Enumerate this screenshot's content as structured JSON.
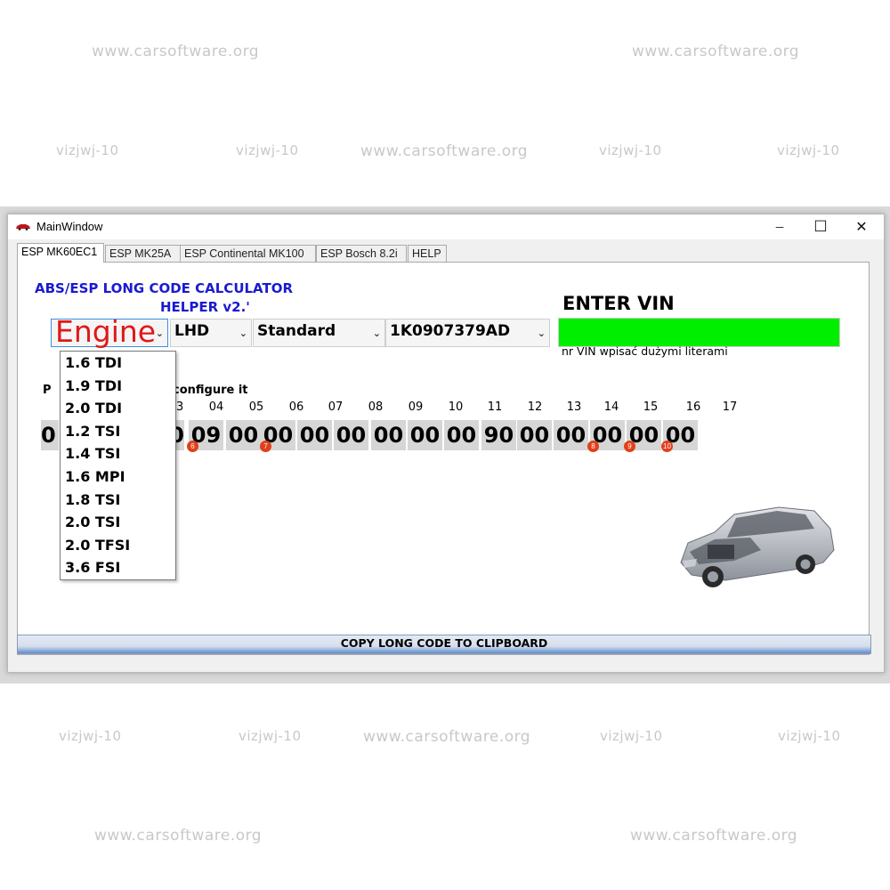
{
  "watermarks": {
    "site": "www.carsoftware.org",
    "code": "vizjwj-10"
  },
  "window": {
    "title": "MainWindow",
    "controls": {
      "minimize": "─",
      "maximize": "☐",
      "close": "✕"
    }
  },
  "tabs": [
    {
      "label": "ESP MK60EC1",
      "active": true
    },
    {
      "label": "ESP MK25A",
      "active": false
    },
    {
      "label": "ESP Continental MK100",
      "active": false
    },
    {
      "label": "ESP Bosch 8.2i",
      "active": false
    },
    {
      "label": "HELP",
      "active": false
    }
  ],
  "panel": {
    "heading_line1": "ABS/ESP LONG CODE CALCULATOR",
    "heading_line2": "HELPER v2.'",
    "heading_color": "#1a1ad0",
    "combos": {
      "engine": {
        "value": "Engine"
      },
      "drive": {
        "value": "LHD"
      },
      "variant": {
        "value": "Standard"
      },
      "part_number": {
        "value": "1K0907379AD"
      }
    },
    "engine_options": [
      "1.6 TDI",
      "1.9 TDI",
      "2.0 TDI",
      "1.2 TSI",
      "1.4 TSI",
      "1.6 MPI",
      "1.8 TSI",
      "2.0 TSI",
      "2.0 TFSI",
      "3.6 FSI"
    ],
    "vin": {
      "label": "ENTER VIN",
      "value": "",
      "hint": "nr VIN wpisać dużymi literami",
      "box_color": "#00ee00"
    },
    "instruction_left": "P",
    "instruction_right": "configure it",
    "column_numbers": [
      "03",
      "04",
      "05",
      "06",
      "07",
      "08",
      "09",
      "10",
      "11",
      "12",
      "13",
      "14",
      "15",
      "16",
      "17"
    ],
    "bytes_visible": [
      "0",
      "0",
      "09",
      "00",
      "00",
      "00",
      "00",
      "00",
      "00",
      "00",
      "90",
      "00",
      "00",
      "00",
      "00",
      "00"
    ],
    "markers": [
      "6",
      "7",
      "8",
      "9",
      "10"
    ],
    "copy_button": "COPY LONG CODE TO CLIPBOARD"
  }
}
